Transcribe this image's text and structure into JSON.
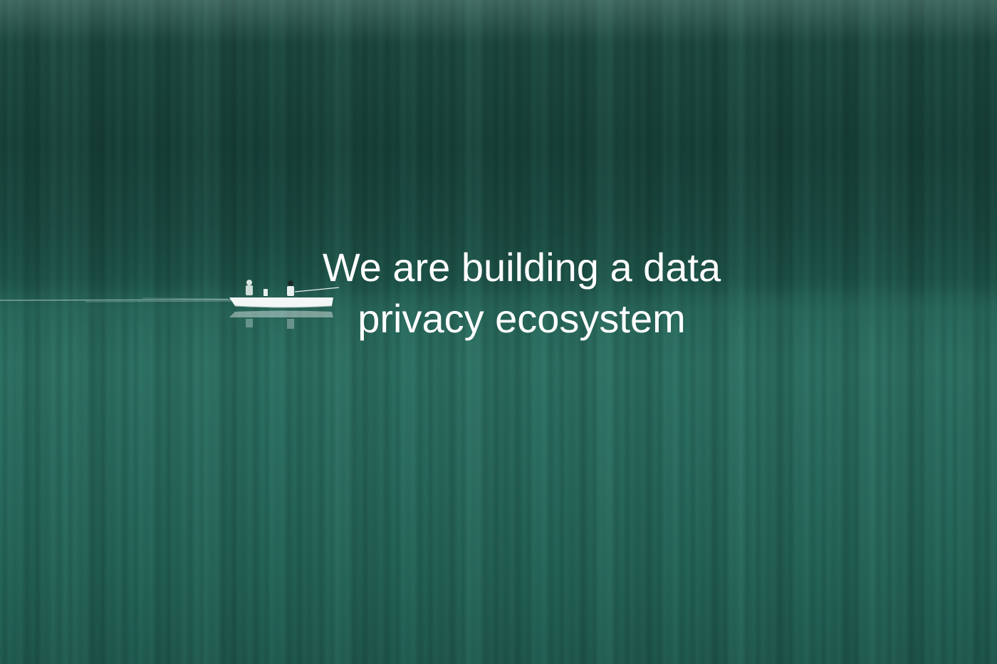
{
  "headline": {
    "line1": "We are building a data",
    "line2": "privacy ecosystem"
  },
  "colors": {
    "text": "#ffffff",
    "water": "#2e7466",
    "forest": "#17423a"
  }
}
